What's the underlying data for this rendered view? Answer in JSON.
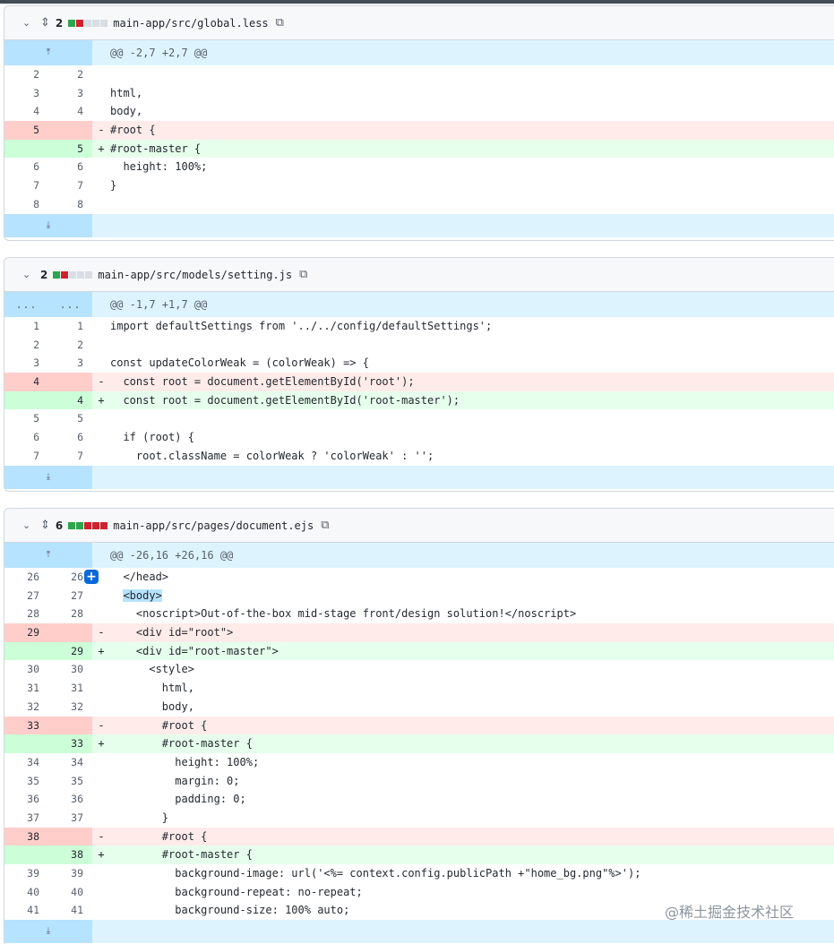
{
  "files": [
    {
      "changes": "2",
      "name": "main-app/src/global.less",
      "stat": [
        "g",
        "r",
        "n",
        "n",
        "n"
      ],
      "hunk": "@@ -2,7 +2,7 @@",
      "lines": [
        {
          "t": "ctx",
          "o": "2",
          "n": "2",
          "c": ""
        },
        {
          "t": "ctx",
          "o": "3",
          "n": "3",
          "c": "html,"
        },
        {
          "t": "ctx",
          "o": "4",
          "n": "4",
          "c": "body,"
        },
        {
          "t": "del",
          "o": "5",
          "n": "",
          "c": "#root {"
        },
        {
          "t": "add",
          "o": "",
          "n": "5",
          "c": "#root-master {"
        },
        {
          "t": "ctx",
          "o": "6",
          "n": "6",
          "c": "  height: 100%;"
        },
        {
          "t": "ctx",
          "o": "7",
          "n": "7",
          "c": "}"
        },
        {
          "t": "ctx",
          "o": "8",
          "n": "8",
          "c": ""
        }
      ]
    },
    {
      "changes": "2",
      "name": "main-app/src/models/setting.js",
      "stat": [
        "g",
        "r",
        "n",
        "n",
        "n"
      ],
      "hunk": "@@ -1,7 +1,7 @@",
      "lines": [
        {
          "t": "ctx",
          "o": "1",
          "n": "1",
          "c": "import defaultSettings from '../../config/defaultSettings';"
        },
        {
          "t": "ctx",
          "o": "2",
          "n": "2",
          "c": ""
        },
        {
          "t": "ctx",
          "o": "3",
          "n": "3",
          "c": "const updateColorWeak = (colorWeak) => {"
        },
        {
          "t": "del",
          "o": "4",
          "n": "",
          "c": "  const root = document.getElementById('root');"
        },
        {
          "t": "add",
          "o": "",
          "n": "4",
          "c": "  const root = document.getElementById('root-master');"
        },
        {
          "t": "ctx",
          "o": "5",
          "n": "5",
          "c": ""
        },
        {
          "t": "ctx",
          "o": "6",
          "n": "6",
          "c": "  if (root) {"
        },
        {
          "t": "ctx",
          "o": "7",
          "n": "7",
          "c": "    root.className = colorWeak ? 'colorWeak' : '';"
        }
      ]
    },
    {
      "changes": "6",
      "name": "main-app/src/pages/document.ejs",
      "stat": [
        "g",
        "g",
        "r",
        "r",
        "r"
      ],
      "hunk": "@@ -26,16 +26,16 @@",
      "lines": [
        {
          "t": "ctx",
          "o": "26",
          "n": "26",
          "c": "  </head>"
        },
        {
          "t": "ctx",
          "o": "27",
          "n": "27",
          "c": "  <body>"
        },
        {
          "t": "ctx",
          "o": "28",
          "n": "28",
          "c": "    <noscript>Out-of-the-box mid-stage front/design solution!</noscript>"
        },
        {
          "t": "del",
          "o": "29",
          "n": "",
          "c": "    <div id=\"root\">"
        },
        {
          "t": "add",
          "o": "",
          "n": "29",
          "c": "    <div id=\"root-master\">"
        },
        {
          "t": "ctx",
          "o": "30",
          "n": "30",
          "c": "      <style>"
        },
        {
          "t": "ctx",
          "o": "31",
          "n": "31",
          "c": "        html,"
        },
        {
          "t": "ctx",
          "o": "32",
          "n": "32",
          "c": "        body,"
        },
        {
          "t": "del",
          "o": "33",
          "n": "",
          "c": "        #root {"
        },
        {
          "t": "add",
          "o": "",
          "n": "33",
          "c": "        #root-master {"
        },
        {
          "t": "ctx",
          "o": "34",
          "n": "34",
          "c": "          height: 100%;"
        },
        {
          "t": "ctx",
          "o": "35",
          "n": "35",
          "c": "          margin: 0;"
        },
        {
          "t": "ctx",
          "o": "36",
          "n": "36",
          "c": "          padding: 0;"
        },
        {
          "t": "ctx",
          "o": "37",
          "n": "37",
          "c": "        }"
        },
        {
          "t": "del",
          "o": "38",
          "n": "",
          "c": "        #root {"
        },
        {
          "t": "add",
          "o": "",
          "n": "38",
          "c": "        #root-master {"
        },
        {
          "t": "ctx",
          "o": "39",
          "n": "39",
          "c": "          background-image: url('<%= context.config.publicPath +\"home_bg.png\"%>');"
        },
        {
          "t": "ctx",
          "o": "40",
          "n": "40",
          "c": "          background-repeat: no-repeat;"
        },
        {
          "t": "ctx",
          "o": "41",
          "n": "41",
          "c": "          background-size: 100% auto;"
        }
      ]
    }
  ],
  "hunk_ellipsis": "...",
  "watermark": "@稀土掘金技术社区"
}
